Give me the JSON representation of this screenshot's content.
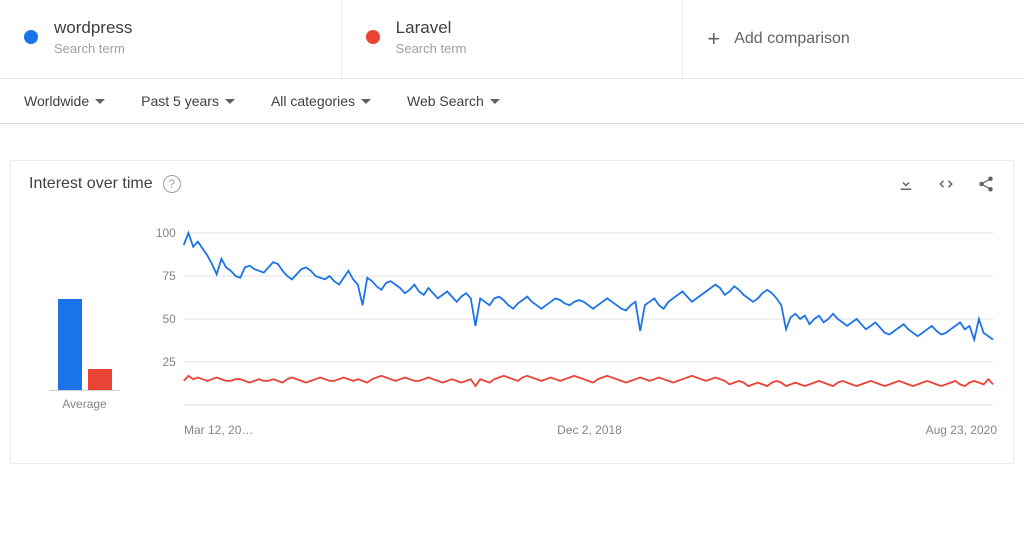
{
  "terms": [
    {
      "name": "wordpress",
      "sub": "Search term",
      "color": "#1a73e8"
    },
    {
      "name": "Laravel",
      "sub": "Search term",
      "color": "#ea4335"
    }
  ],
  "add_comparison_label": "Add comparison",
  "filters": {
    "region": "Worldwide",
    "time": "Past 5 years",
    "category": "All categories",
    "search_type": "Web Search"
  },
  "panel": {
    "title": "Interest over time",
    "average_label": "Average"
  },
  "x_ticks": [
    "Mar 12, 20…",
    "Dec 2, 2018",
    "Aug 23, 2020"
  ],
  "averages": {
    "wordpress": 61,
    "laravel": 14
  },
  "chart_data": {
    "type": "line",
    "title": "Interest over time",
    "xlabel": "",
    "ylabel": "",
    "ylim": [
      0,
      100
    ],
    "y_ticks": [
      25,
      50,
      75,
      100
    ],
    "x_tick_labels": [
      "Mar 12, 20…",
      "Dec 2, 2018",
      "Aug 23, 2020"
    ],
    "series": [
      {
        "name": "wordpress",
        "color": "#1a73e8",
        "values": [
          93,
          100,
          92,
          95,
          91,
          87,
          82,
          76,
          85,
          80,
          78,
          75,
          74,
          80,
          81,
          79,
          78,
          77,
          80,
          83,
          82,
          78,
          75,
          73,
          76,
          79,
          80,
          78,
          75,
          74,
          73,
          75,
          72,
          70,
          74,
          78,
          73,
          70,
          58,
          74,
          72,
          69,
          67,
          71,
          72,
          70,
          68,
          65,
          67,
          70,
          66,
          64,
          68,
          65,
          62,
          64,
          66,
          63,
          60,
          63,
          65,
          62,
          46,
          62,
          60,
          58,
          62,
          63,
          61,
          58,
          56,
          59,
          61,
          63,
          60,
          58,
          56,
          58,
          60,
          62,
          61,
          59,
          58,
          60,
          61,
          60,
          58,
          56,
          58,
          60,
          62,
          60,
          58,
          56,
          55,
          58,
          60,
          43,
          58,
          60,
          62,
          58,
          56,
          60,
          62,
          64,
          66,
          63,
          60,
          62,
          64,
          66,
          68,
          70,
          68,
          64,
          66,
          69,
          67,
          64,
          62,
          60,
          62,
          65,
          67,
          65,
          62,
          58,
          44,
          51,
          53,
          50,
          52,
          47,
          50,
          52,
          48,
          50,
          53,
          50,
          48,
          46,
          48,
          50,
          47,
          44,
          46,
          48,
          45,
          42,
          41,
          43,
          45,
          47,
          44,
          42,
          40,
          42,
          44,
          46,
          43,
          41,
          42,
          44,
          46,
          48,
          44,
          46,
          38,
          50,
          42,
          40,
          38
        ]
      },
      {
        "name": "Laravel",
        "color": "#ea4335",
        "values": [
          14,
          17,
          15,
          16,
          15,
          14,
          15,
          16,
          15,
          14,
          14,
          15,
          15,
          14,
          13,
          14,
          15,
          14,
          14,
          15,
          14,
          13,
          15,
          16,
          15,
          14,
          13,
          14,
          15,
          16,
          15,
          14,
          14,
          15,
          16,
          15,
          14,
          15,
          14,
          13,
          15,
          16,
          17,
          16,
          15,
          14,
          15,
          16,
          15,
          14,
          14,
          15,
          16,
          15,
          14,
          13,
          14,
          15,
          14,
          13,
          14,
          15,
          11,
          15,
          14,
          13,
          15,
          16,
          17,
          16,
          15,
          14,
          16,
          17,
          16,
          15,
          14,
          15,
          16,
          15,
          14,
          15,
          16,
          17,
          16,
          15,
          14,
          13,
          15,
          16,
          17,
          16,
          15,
          14,
          13,
          14,
          15,
          16,
          15,
          14,
          15,
          16,
          15,
          14,
          13,
          14,
          15,
          16,
          17,
          16,
          15,
          14,
          15,
          16,
          15,
          14,
          12,
          13,
          14,
          13,
          11,
          12,
          13,
          12,
          11,
          13,
          14,
          13,
          11,
          12,
          13,
          12,
          11,
          12,
          13,
          14,
          13,
          12,
          11,
          13,
          14,
          13,
          12,
          11,
          12,
          13,
          14,
          13,
          12,
          11,
          12,
          13,
          14,
          13,
          12,
          11,
          12,
          13,
          14,
          13,
          12,
          11,
          12,
          13,
          14,
          12,
          11,
          13,
          14,
          13,
          12,
          15,
          12
        ]
      }
    ]
  }
}
